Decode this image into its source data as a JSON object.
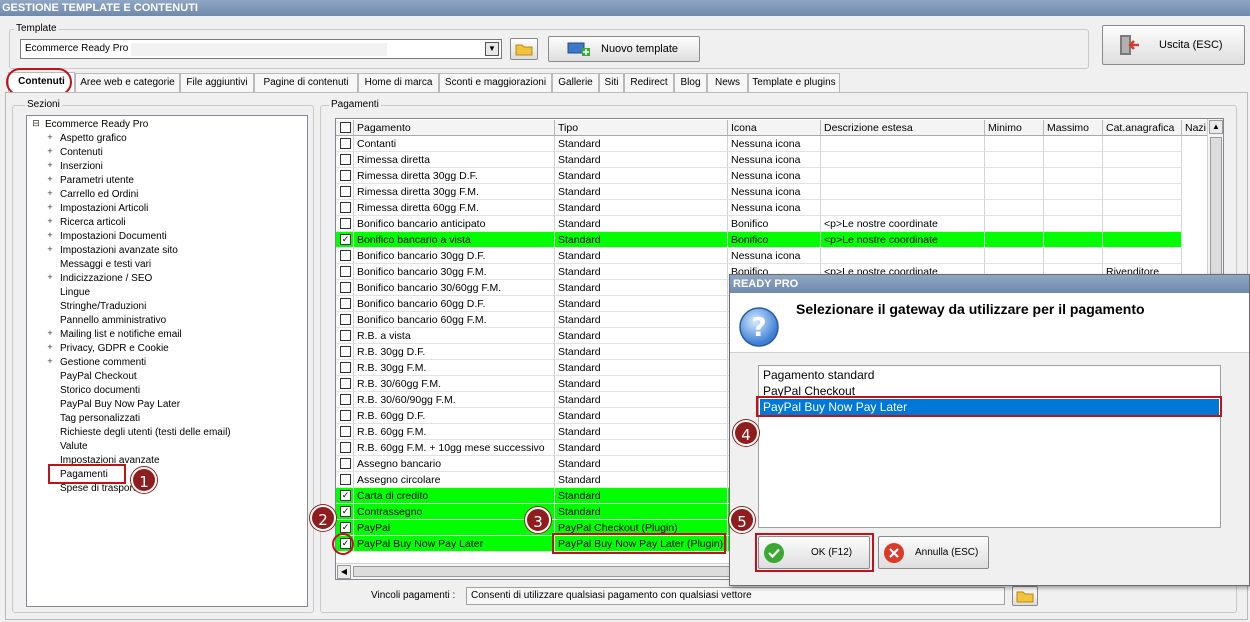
{
  "window_title": "GESTIONE TEMPLATE E CONTENUTI",
  "template_group": {
    "label": "Template",
    "selected": "Ecommerce Ready Pro",
    "new_template_label": "Nuovo template",
    "exit_label": "Uscita (ESC)"
  },
  "tabs": [
    "Contenuti",
    "Aree web e categorie",
    "File aggiuntivi",
    "Pagine di contenuti",
    "Home di marca",
    "Sconti e maggiorazioni",
    "Gallerie",
    "Siti",
    "Redirect",
    "Blog",
    "News",
    "Template e plugins"
  ],
  "sections": {
    "label": "Sezioni",
    "root": "Ecommerce Ready Pro",
    "items": [
      {
        "label": "Aspetto grafico",
        "expandable": true
      },
      {
        "label": "Contenuti",
        "expandable": true
      },
      {
        "label": "Inserzioni",
        "expandable": true
      },
      {
        "label": "Parametri utente",
        "expandable": true
      },
      {
        "label": "Carrello ed Ordini",
        "expandable": true
      },
      {
        "label": "Impostazioni Articoli",
        "expandable": true
      },
      {
        "label": "Ricerca articoli",
        "expandable": true
      },
      {
        "label": "Impostazioni Documenti",
        "expandable": true
      },
      {
        "label": "Impostazioni avanzate sito",
        "expandable": true
      },
      {
        "label": "Messaggi e testi vari",
        "expandable": false
      },
      {
        "label": "Indicizzazione / SEO",
        "expandable": true
      },
      {
        "label": "Lingue",
        "expandable": false
      },
      {
        "label": "Stringhe/Traduzioni",
        "expandable": false
      },
      {
        "label": "Pannello amministrativo",
        "expandable": false
      },
      {
        "label": "Mailing list e notifiche email",
        "expandable": true
      },
      {
        "label": "Privacy, GDPR e Cookie",
        "expandable": true
      },
      {
        "label": "Gestione commenti",
        "expandable": true
      },
      {
        "label": "PayPal Checkout",
        "expandable": false
      },
      {
        "label": "Storico documenti",
        "expandable": false
      },
      {
        "label": "PayPal Buy Now Pay Later",
        "expandable": false
      },
      {
        "label": "Tag personalizzati",
        "expandable": false
      },
      {
        "label": "Richieste degli utenti (testi delle email)",
        "expandable": false
      },
      {
        "label": "Valute",
        "expandable": false
      },
      {
        "label": "Impostazioni avanzate",
        "expandable": false
      },
      {
        "label": "Pagamenti",
        "expandable": false
      },
      {
        "label": "Spese di trasporto",
        "expandable": false
      }
    ]
  },
  "payments": {
    "label": "Pagamenti",
    "columns": [
      "Pagamento",
      "Tipo",
      "Icona",
      "Descrizione estesa",
      "Minimo",
      "Massimo",
      "Cat.anagrafica",
      "Nazi"
    ],
    "rows": [
      {
        "checked": false,
        "highlight": false,
        "cells": [
          "Contanti",
          "Standard",
          "Nessuna icona",
          "",
          "",
          "",
          ""
        ]
      },
      {
        "checked": false,
        "highlight": false,
        "cells": [
          "Rimessa diretta",
          "Standard",
          "Nessuna icona",
          "",
          "",
          "",
          ""
        ]
      },
      {
        "checked": false,
        "highlight": false,
        "cells": [
          "Rimessa diretta 30gg D.F.",
          "Standard",
          "Nessuna icona",
          "",
          "",
          "",
          ""
        ]
      },
      {
        "checked": false,
        "highlight": false,
        "cells": [
          "Rimessa diretta 30gg F.M.",
          "Standard",
          "Nessuna icona",
          "",
          "",
          "",
          ""
        ]
      },
      {
        "checked": false,
        "highlight": false,
        "cells": [
          "Rimessa diretta 60gg F.M.",
          "Standard",
          "Nessuna icona",
          "",
          "",
          "",
          ""
        ]
      },
      {
        "checked": false,
        "highlight": false,
        "cells": [
          "Bonifico bancario anticipato",
          "Standard",
          "Bonifico",
          "<p>Le nostre coordinate",
          "",
          "",
          ""
        ]
      },
      {
        "checked": true,
        "highlight": true,
        "cells": [
          "Bonifico bancario a vista",
          "Standard",
          "Bonifico",
          "<p>Le nostre coordinate",
          "",
          "",
          ""
        ]
      },
      {
        "checked": false,
        "highlight": false,
        "cells": [
          "Bonifico bancario 30gg D.F.",
          "Standard",
          "Nessuna icona",
          "",
          "",
          "",
          ""
        ]
      },
      {
        "checked": false,
        "highlight": false,
        "cells": [
          "Bonifico bancario 30gg F.M.",
          "Standard",
          "Bonifico",
          "<p>Le nostre coordinate",
          "",
          "",
          "Rivenditore"
        ]
      },
      {
        "checked": false,
        "highlight": false,
        "cells": [
          "Bonifico bancario 30/60gg F.M.",
          "Standard",
          "",
          "",
          "",
          "",
          ""
        ]
      },
      {
        "checked": false,
        "highlight": false,
        "cells": [
          "Bonifico bancario 60gg D.F.",
          "Standard",
          "",
          "",
          "",
          "",
          ""
        ]
      },
      {
        "checked": false,
        "highlight": false,
        "cells": [
          "Bonifico bancario 60gg F.M.",
          "Standard",
          "",
          "",
          "",
          "",
          ""
        ]
      },
      {
        "checked": false,
        "highlight": false,
        "cells": [
          "R.B. a vista",
          "Standard",
          "",
          "",
          "",
          "",
          ""
        ]
      },
      {
        "checked": false,
        "highlight": false,
        "cells": [
          "R.B. 30gg D.F.",
          "Standard",
          "",
          "",
          "",
          "",
          ""
        ]
      },
      {
        "checked": false,
        "highlight": false,
        "cells": [
          "R.B. 30gg F.M.",
          "Standard",
          "",
          "",
          "",
          "",
          ""
        ]
      },
      {
        "checked": false,
        "highlight": false,
        "cells": [
          "R.B. 30/60gg F.M.",
          "Standard",
          "",
          "",
          "",
          "",
          ""
        ]
      },
      {
        "checked": false,
        "highlight": false,
        "cells": [
          "R.B. 30/60/90gg F.M.",
          "Standard",
          "",
          "",
          "",
          "",
          ""
        ]
      },
      {
        "checked": false,
        "highlight": false,
        "cells": [
          "R.B. 60gg D.F.",
          "Standard",
          "",
          "",
          "",
          "",
          ""
        ]
      },
      {
        "checked": false,
        "highlight": false,
        "cells": [
          "R.B. 60gg F.M.",
          "Standard",
          "",
          "",
          "",
          "",
          ""
        ]
      },
      {
        "checked": false,
        "highlight": false,
        "cells": [
          "R.B. 60gg F.M. + 10gg mese successivo",
          "Standard",
          "",
          "",
          "",
          "",
          ""
        ]
      },
      {
        "checked": false,
        "highlight": false,
        "cells": [
          "Assegno bancario",
          "Standard",
          "",
          "",
          "",
          "",
          ""
        ]
      },
      {
        "checked": false,
        "highlight": false,
        "cells": [
          "Assegno circolare",
          "Standard",
          "",
          "",
          "",
          "",
          ""
        ]
      },
      {
        "checked": true,
        "highlight": true,
        "cells": [
          "Carta di credito",
          "Standard",
          "",
          "",
          "",
          "",
          ""
        ]
      },
      {
        "checked": true,
        "highlight": true,
        "cells": [
          "Contrassegno",
          "Standard",
          "",
          "",
          "",
          "",
          ""
        ]
      },
      {
        "checked": true,
        "highlight": true,
        "cells": [
          "PayPal",
          "PayPal Checkout (Plugin)",
          "",
          "",
          "",
          "",
          ""
        ]
      },
      {
        "checked": true,
        "highlight": true,
        "cells": [
          "PayPal Buy Now Pay Later",
          "PayPal Buy Now Pay Later (Plugin)",
          "",
          "",
          "",
          "",
          ""
        ]
      }
    ],
    "constraints_label": "Vincoli pagamenti :",
    "constraints_value": "Consenti di utilizzare qualsiasi pagamento con qualsiasi vettore"
  },
  "dialog": {
    "title": "READY PRO",
    "message": "Selezionare il gateway da utilizzare per il pagamento",
    "options": [
      "Pagamento standard",
      "PayPal Checkout",
      "PayPal Buy Now Pay Later"
    ],
    "selected_index": 2,
    "ok_label": "OK (F12)",
    "cancel_label": "Annulla (ESC)"
  },
  "markers": [
    "1",
    "2",
    "3",
    "4",
    "5"
  ],
  "colors": {
    "highlight": "#00ff00",
    "selection": "#0078d7",
    "annotation": "#c0121a"
  }
}
